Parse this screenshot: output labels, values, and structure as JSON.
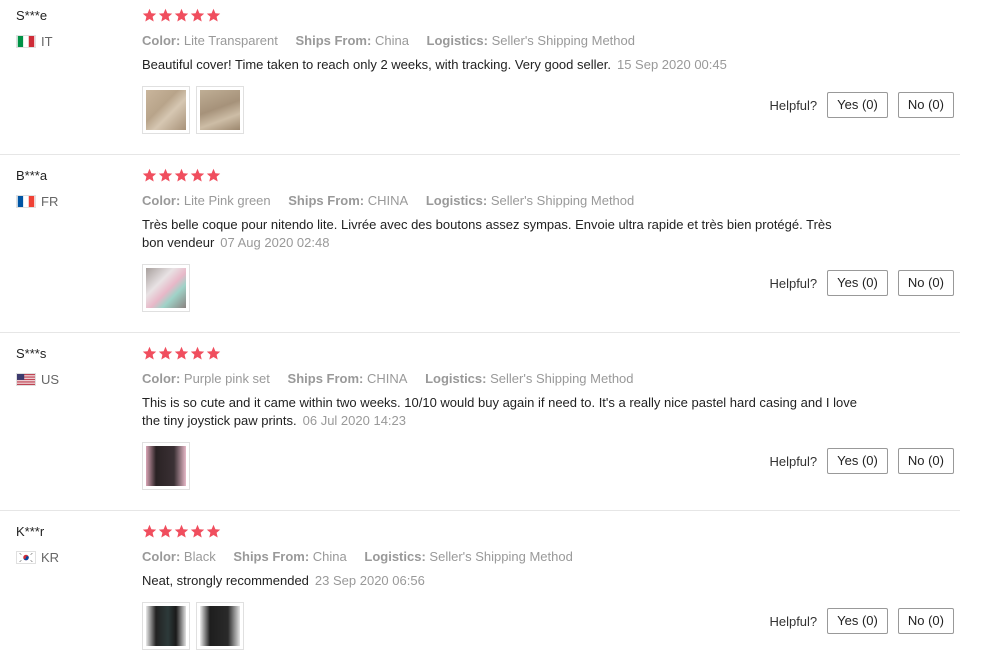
{
  "labels": {
    "color": "Color:",
    "ships_from": "Ships From:",
    "logistics": "Logistics:",
    "helpful": "Helpful?"
  },
  "star_color": "#f04e5e",
  "reviews": [
    {
      "user": "S***e",
      "country": "IT",
      "rating": 5,
      "color": "Lite Transparent",
      "ships_from": "China",
      "logistics": "Seller's Shipping Method",
      "feedback": "Beautiful cover! Time taken to reach only 2 weeks, with tracking. Very good seller.",
      "date": "15 Sep 2020 00:45",
      "photos": 2,
      "yes": "Yes (0)",
      "no": "No (0)"
    },
    {
      "user": "B***a",
      "country": "FR",
      "rating": 5,
      "color": "Lite Pink green",
      "ships_from": "CHINA",
      "logistics": "Seller's Shipping Method",
      "feedback": "Très belle coque pour nitendo lite. Livrée avec des boutons assez sympas. Envoie ultra rapide et très bien protégé. Très bon vendeur",
      "date": "07 Aug 2020 02:48",
      "photos": 1,
      "yes": "Yes (0)",
      "no": "No (0)"
    },
    {
      "user": "S***s",
      "country": "US",
      "rating": 5,
      "color": "Purple pink set",
      "ships_from": "CHINA",
      "logistics": "Seller's Shipping Method",
      "feedback": "This is so cute and it came within two weeks. 10/10 would buy again if need to. It's a really nice pastel hard casing and I love the tiny joystick paw prints.",
      "date": "06 Jul 2020 14:23",
      "photos": 1,
      "yes": "Yes (0)",
      "no": "No (0)"
    },
    {
      "user": "K***r",
      "country": "KR",
      "rating": 5,
      "color": "Black",
      "ships_from": "China",
      "logistics": "Seller's Shipping Method",
      "feedback": "Neat, strongly recommended",
      "date": "23 Sep 2020 06:56",
      "photos": 2,
      "yes": "Yes (0)",
      "no": "No (0)"
    }
  ]
}
